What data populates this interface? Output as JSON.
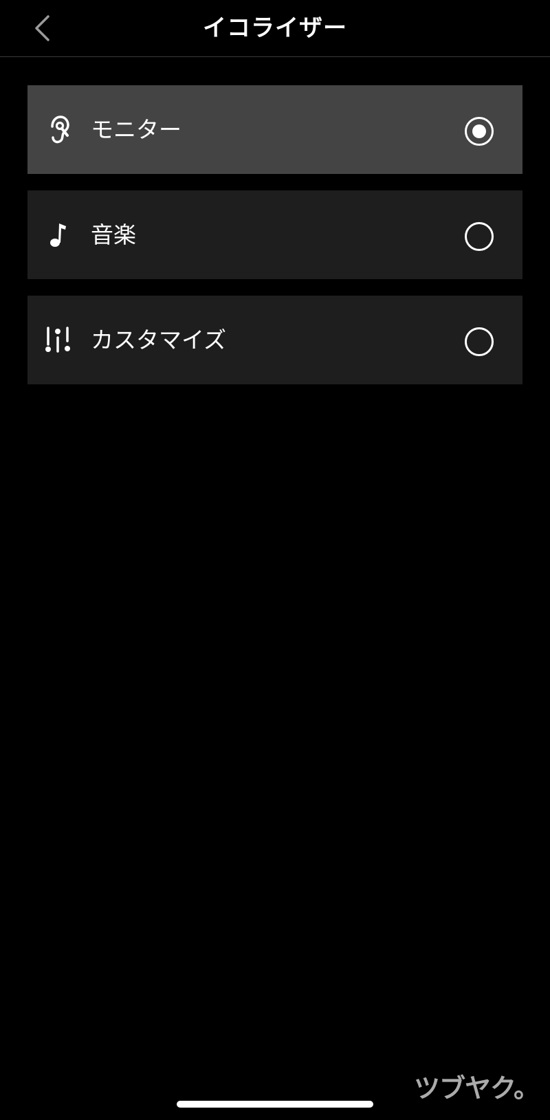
{
  "header": {
    "title": "イコライザー",
    "back_icon": "chevron-left-icon"
  },
  "options": [
    {
      "label": "モニター",
      "icon": "ear-icon",
      "selected": true
    },
    {
      "label": "音楽",
      "icon": "music-note-icon",
      "selected": false
    },
    {
      "label": "カスタマイズ",
      "icon": "sliders-icon",
      "selected": false
    }
  ],
  "watermark": {
    "text": "ツブヤク。"
  },
  "colors": {
    "background": "#000000",
    "selected_row": "#444444",
    "row": "#1e1e1e",
    "text": "#ffffff"
  }
}
